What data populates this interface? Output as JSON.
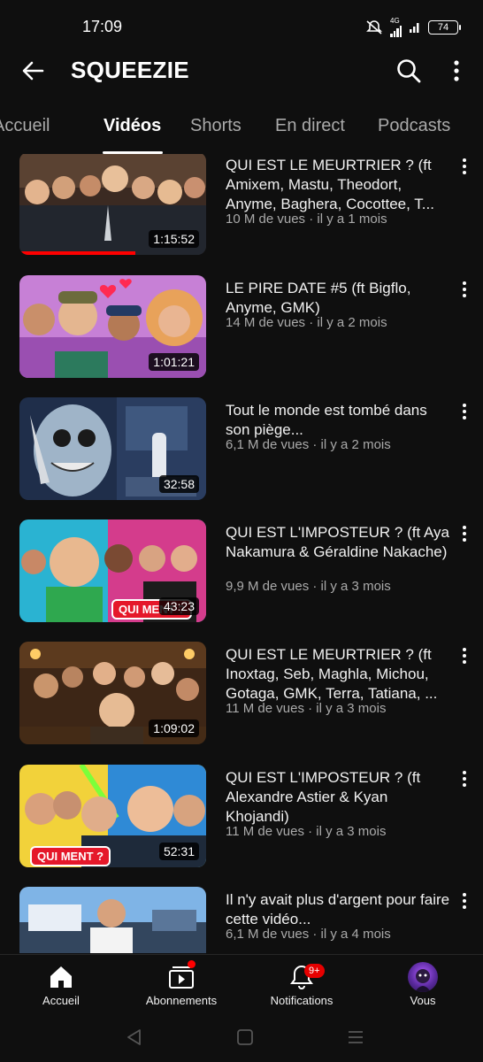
{
  "status": {
    "time": "17:09",
    "network": "4G",
    "battery": "74"
  },
  "header": {
    "title": "SQUEEZIE"
  },
  "tabs": [
    "Accueil",
    "Vidéos",
    "Shorts",
    "En direct",
    "Podcasts"
  ],
  "videos": [
    {
      "title": "QUI EST LE MEURTRIER ? (ft Amixem, Mastu, Theodort, Anyme, Baghera, Cocottee, T...",
      "meta": "10 M de vues · il y a 1 mois",
      "duration": "1:15:52",
      "watched": 0.62
    },
    {
      "title": "LE PIRE DATE #5 (ft Bigflo, Anyme, GMK)",
      "meta": "14 M de vues · il y a 2 mois",
      "duration": "1:01:21"
    },
    {
      "title": "Tout le monde est tombé dans son piège...",
      "meta": "6,1 M de vues · il y a 2 mois",
      "duration": "32:58"
    },
    {
      "title": "QUI EST L'IMPOSTEUR ? (ft Aya Nakamura & Géraldine Nakache)",
      "meta": "9,9 M de vues · il y a 3 mois",
      "duration": "43:23",
      "badge": "QUI MENT ?"
    },
    {
      "title": "QUI EST LE MEURTRIER ? (ft Inoxtag, Seb, Maghla, Michou, Gotaga, GMK, Terra, Tatiana, ...",
      "meta": "11 M de vues · il y a 3 mois",
      "duration": "1:09:02"
    },
    {
      "title": "QUI EST L'IMPOSTEUR ? (ft Alexandre Astier & Kyan Khojandi)",
      "meta": "11 M de vues · il y a 3 mois",
      "duration": "52:31",
      "badge": "QUI MENT ?"
    },
    {
      "title": "Il n'y avait plus d'argent pour faire cette vidéo...",
      "meta": "6,1 M de vues · il y a 4 mois"
    }
  ],
  "bottom_nav": [
    {
      "label": "Accueil",
      "icon": "home-icon"
    },
    {
      "label": "Abonnements",
      "icon": "subscriptions-icon"
    },
    {
      "label": "Notifications",
      "icon": "bell-icon",
      "badge": "9+"
    },
    {
      "label": "Vous",
      "icon": "avatar"
    }
  ],
  "colors": {
    "background": "#0f0f0f",
    "accent": "#ff0000",
    "secondary_text": "#aaaaaa"
  }
}
